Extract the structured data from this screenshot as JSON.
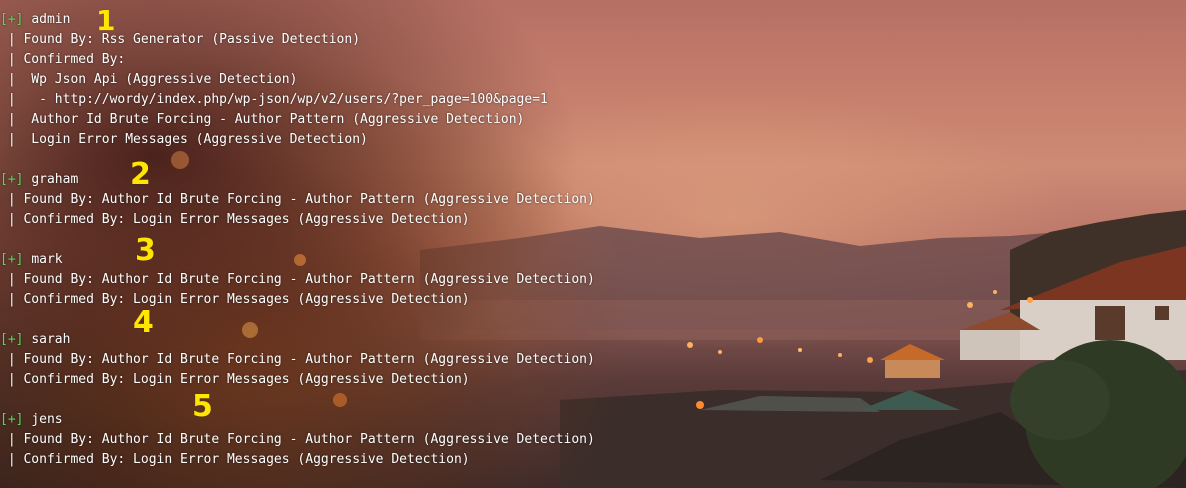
{
  "terminal": {
    "users": [
      {
        "tag": "[+]",
        "name": "admin",
        "lines": [
          " | Found By: Rss Generator (Passive Detection)",
          " | Confirmed By:",
          " |  Wp Json Api (Aggressive Detection)",
          " |   - http://wordy/index.php/wp-json/wp/v2/users/?per_page=100&page=1",
          " |  Author Id Brute Forcing - Author Pattern (Aggressive Detection)",
          " |  Login Error Messages (Aggressive Detection)"
        ]
      },
      {
        "tag": "[+]",
        "name": "graham",
        "lines": [
          " | Found By: Author Id Brute Forcing - Author Pattern (Aggressive Detection)",
          " | Confirmed By: Login Error Messages (Aggressive Detection)"
        ]
      },
      {
        "tag": "[+]",
        "name": "mark",
        "lines": [
          " | Found By: Author Id Brute Forcing - Author Pattern (Aggressive Detection)",
          " | Confirmed By: Login Error Messages (Aggressive Detection)"
        ]
      },
      {
        "tag": "[+]",
        "name": "sarah",
        "lines": [
          " | Found By: Author Id Brute Forcing - Author Pattern (Aggressive Detection)",
          " | Confirmed By: Login Error Messages (Aggressive Detection)"
        ]
      },
      {
        "tag": "[+]",
        "name": "jens",
        "lines": [
          " | Found By: Author Id Brute Forcing - Author Pattern (Aggressive Detection)",
          " | Confirmed By: Login Error Messages (Aggressive Detection)"
        ]
      }
    ]
  },
  "annotations": [
    "1",
    "2",
    "3",
    "4",
    "5"
  ],
  "colors": {
    "text": "#ffffff",
    "tag": "#5fd75f",
    "annotation": "#ffe600"
  }
}
